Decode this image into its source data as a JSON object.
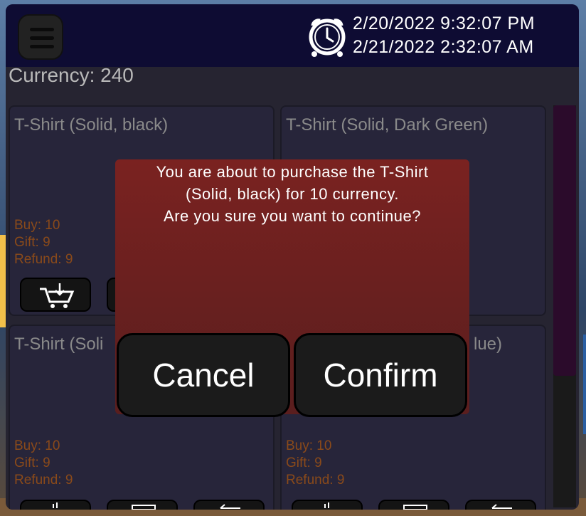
{
  "header": {
    "date_time_1": "2/20/2022 9:32:07 PM",
    "date_time_2": "2/21/2022 2:32:07 AM"
  },
  "currency_label": "Currency: 240",
  "items": [
    {
      "title": "T-Shirt (Solid, black)",
      "buy": "Buy: 10",
      "gift": "Gift: 9",
      "refund": "Refund: 9"
    },
    {
      "title": "T-Shirt (Solid, Dark Green)"
    },
    {
      "title": "T-Shirt (Soli",
      "buy": "Buy: 10",
      "gift": "Gift: 9",
      "refund": "Refund: 9"
    },
    {
      "title": "lue)",
      "buy": "Buy: 10",
      "gift": "Gift: 9",
      "refund": "Refund: 9"
    }
  ],
  "dialog": {
    "line1": "You are about to purchase the T-Shirt",
    "line2": "(Solid, black) for 10 currency.",
    "line3": "Are you sure you want to continue?",
    "cancel_label": "Cancel",
    "confirm_label": "Confirm"
  },
  "icons": [
    "menu-icon",
    "alarm-clock-icon",
    "cart-buy-icon",
    "gift-icon",
    "refund-icon"
  ]
}
